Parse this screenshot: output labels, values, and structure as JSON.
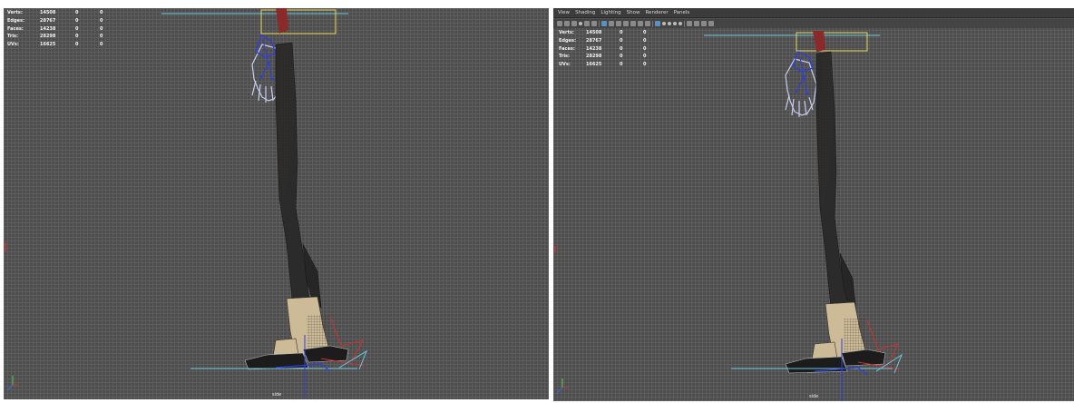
{
  "viewports": {
    "left": {
      "hud": {
        "rows": [
          {
            "label": "Verts:",
            "value": "14508",
            "sel": "0",
            "extra": "0"
          },
          {
            "label": "Edges:",
            "value": "28767",
            "sel": "0",
            "extra": "0"
          },
          {
            "label": "Faces:",
            "value": "14238",
            "sel": "0",
            "extra": "0"
          },
          {
            "label": "Tris:",
            "value": "28298",
            "sel": "0",
            "extra": "0"
          },
          {
            "label": "UVs:",
            "value": "16625",
            "sel": "0",
            "extra": "0"
          }
        ]
      },
      "camera_label": "side"
    },
    "right": {
      "menu": [
        "View",
        "Shading",
        "Lighting",
        "Show",
        "Renderer",
        "Panels"
      ],
      "hud": {
        "rows": [
          {
            "label": "Verts:",
            "value": "14508",
            "sel": "0",
            "extra": "0"
          },
          {
            "label": "Edges:",
            "value": "28767",
            "sel": "0",
            "extra": "0"
          },
          {
            "label": "Faces:",
            "value": "14238",
            "sel": "0",
            "extra": "0"
          },
          {
            "label": "Tris:",
            "value": "28298",
            "sel": "0",
            "extra": "0"
          },
          {
            "label": "UVs:",
            "value": "16625",
            "sel": "0",
            "extra": "0"
          }
        ]
      },
      "camera_label": "side"
    }
  },
  "colors": {
    "viewport_bg": "#4d4d4d",
    "grid": "#5f5f5f",
    "pants": "#2b2b2b",
    "shoe": "#1c1c1c",
    "spat": "#cdbb98",
    "hand_wire": "#b8bfe8",
    "joint": "#2f3fd9",
    "ground": "#6ec6e0",
    "selection": "#e6d95a",
    "control_red": "#d03030"
  }
}
